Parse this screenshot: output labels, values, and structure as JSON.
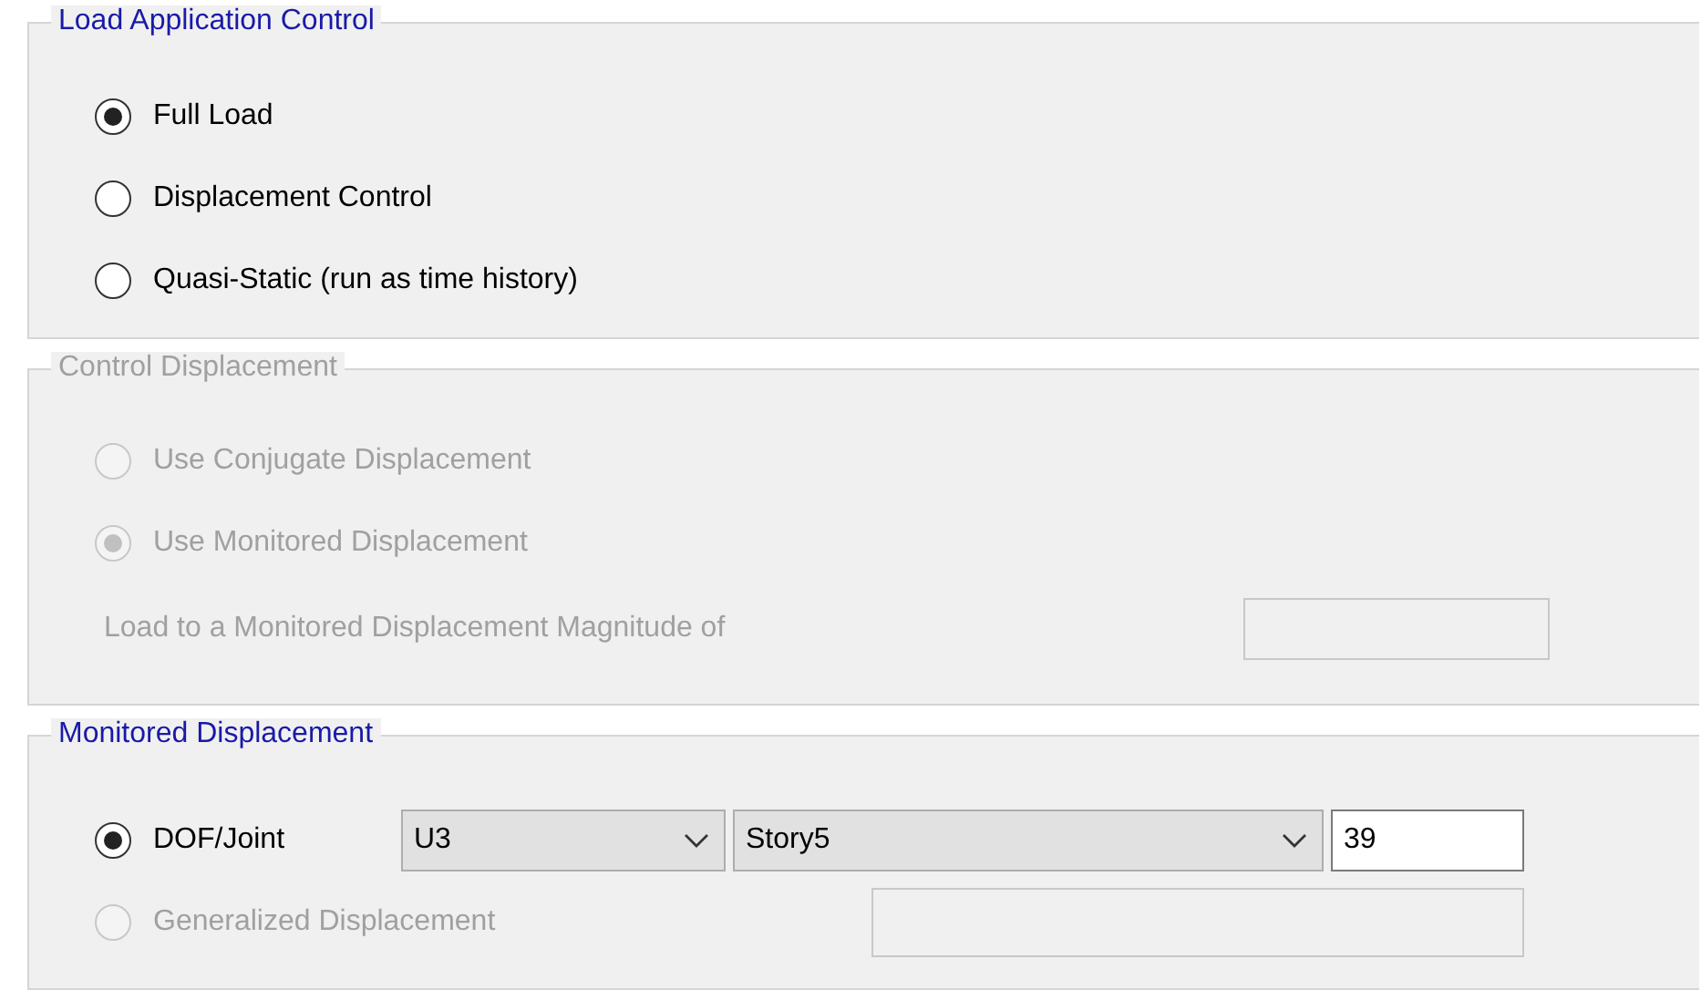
{
  "groups": [
    {
      "title": "Load Application Control",
      "disabled": false,
      "rows": [
        {
          "kind": "radio",
          "label": "Full Load",
          "selected": true,
          "disabled": false
        },
        {
          "kind": "radio",
          "label": "Displacement Control",
          "selected": false,
          "disabled": false
        },
        {
          "kind": "radio",
          "label": "Quasi-Static (run as time history)",
          "selected": false,
          "disabled": false
        }
      ]
    },
    {
      "title": "Control Displacement",
      "disabled": true,
      "rows": [
        {
          "kind": "radio",
          "label": "Use Conjugate Displacement",
          "selected": false,
          "disabled": true
        },
        {
          "kind": "radio",
          "label": "Use Monitored Displacement",
          "selected": true,
          "disabled": true
        },
        {
          "kind": "field",
          "label": "Load to a Monitored Displacement Magnitude of",
          "disabled": true
        }
      ]
    },
    {
      "title": "Monitored Displacement",
      "disabled": false,
      "rows": [
        {
          "kind": "radio_selects",
          "label": "DOF/Joint",
          "selected": true,
          "disabled": false,
          "selects": [
            "U3",
            "Story5"
          ],
          "value": "39"
        },
        {
          "kind": "radio_field",
          "label": "Generalized Displacement",
          "selected": false,
          "disabled": true
        }
      ]
    }
  ]
}
